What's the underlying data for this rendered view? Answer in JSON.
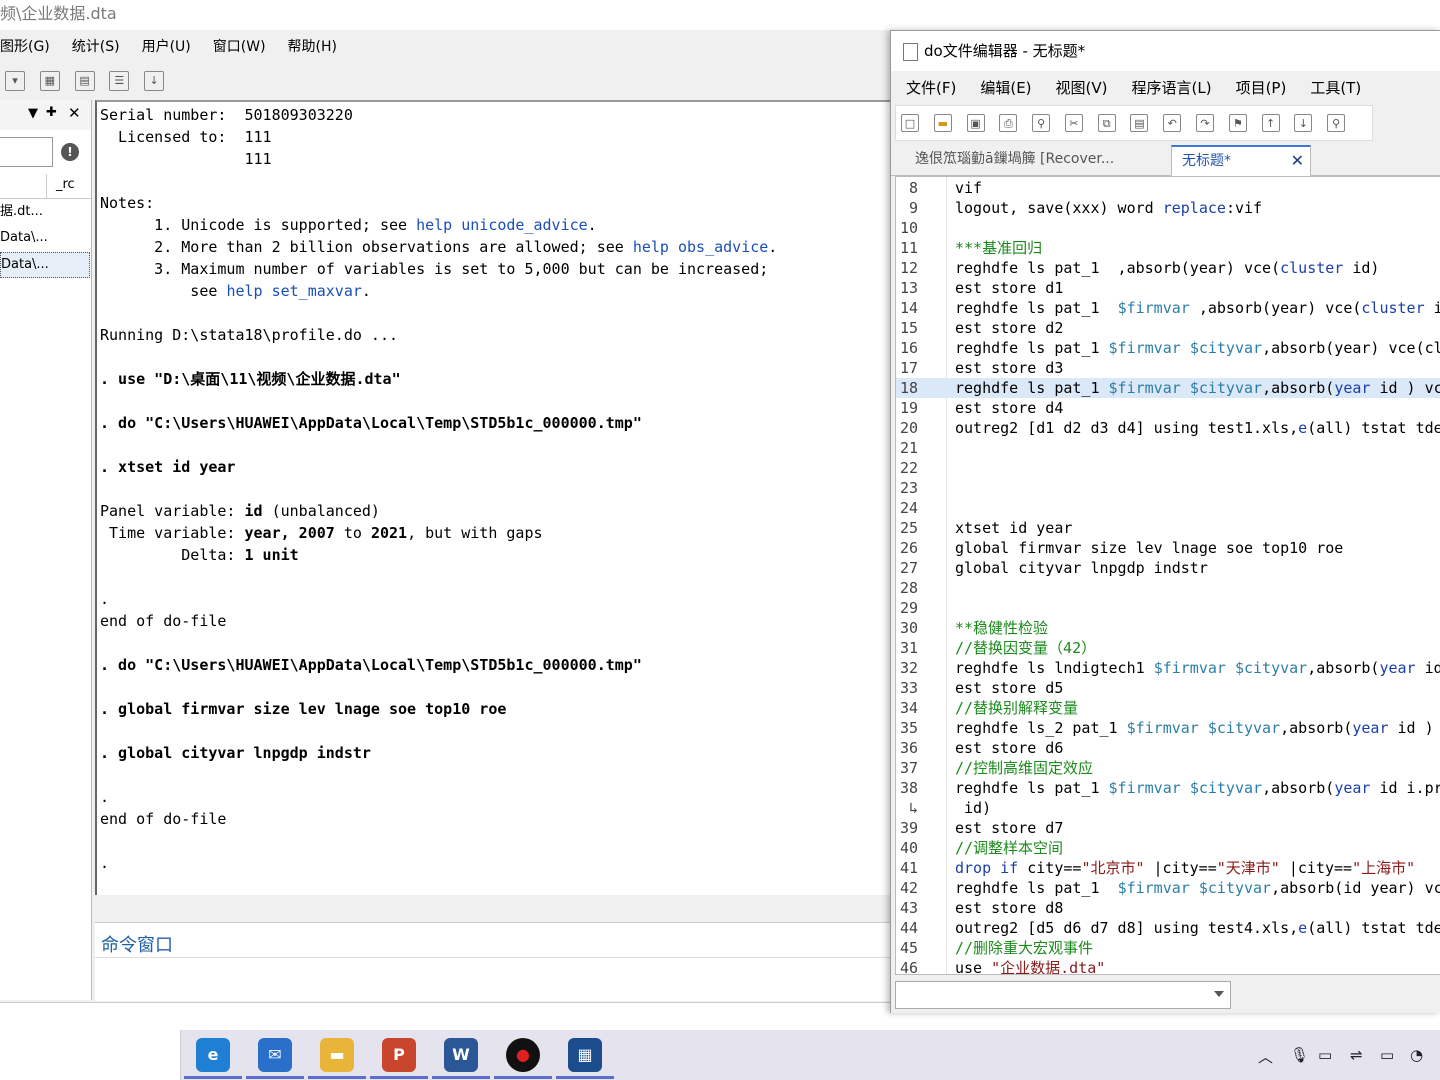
{
  "window": {
    "title": "频\\企业数据.dta"
  },
  "menu": [
    "图形(G)",
    "统计(S)",
    "用户(U)",
    "窗口(W)",
    "帮助(H)"
  ],
  "left_panel": {
    "history_col": "_rc",
    "items": [
      "据.dt...",
      "Data\\...",
      "Data\\..."
    ]
  },
  "results": {
    "lines": [
      {
        "t": "Serial number:  501809303220",
        "b": false
      },
      {
        "t": "  Licensed to:  111",
        "b": false
      },
      {
        "t": "                111",
        "b": false
      },
      {
        "t": "",
        "b": false
      },
      {
        "t": "Notes:",
        "b": false
      },
      {
        "t": "      1. Unicode is supported; see ",
        "b": false,
        "link": "help unicode_advice",
        "end": "."
      },
      {
        "t": "      2. More than 2 billion observations are allowed; see ",
        "b": false,
        "link": "help obs_advice",
        "end": "."
      },
      {
        "t": "      3. Maximum number of variables is set to 5,000 but can be increased;",
        "b": false
      },
      {
        "t": "          see ",
        "b": false,
        "link": "help set_maxvar",
        "end": "."
      },
      {
        "t": "",
        "b": false
      },
      {
        "t": "Running D:\\stata18\\profile.do ...",
        "b": false
      },
      {
        "t": "",
        "b": false
      },
      {
        "t": ". use \"D:\\桌面\\11\\视频\\企业数据.dta\"",
        "b": true
      },
      {
        "t": "",
        "b": false
      },
      {
        "t": ". do \"C:\\Users\\HUAWEI\\AppData\\Local\\Temp\\STD5b1c_000000.tmp\"",
        "b": true
      },
      {
        "t": "",
        "b": false
      },
      {
        "t": ". xtset id year",
        "b": true
      },
      {
        "t": "",
        "b": false
      },
      {
        "t": "Panel variable: ",
        "b": false,
        "bold_tail": "id",
        "tail": " (unbalanced)"
      },
      {
        "t": " Time variable: ",
        "b": false,
        "bold_tail": "year, 2007",
        "tail": " to ",
        "bold_tail2": "2021",
        "tail2": ", but with gaps"
      },
      {
        "t": "         Delta: ",
        "b": false,
        "bold_tail": "1 unit",
        "tail": ""
      },
      {
        "t": "",
        "b": false
      },
      {
        "t": ".",
        "b": false
      },
      {
        "t": "end of do-file",
        "b": false
      },
      {
        "t": "",
        "b": false
      },
      {
        "t": ". do \"C:\\Users\\HUAWEI\\AppData\\Local\\Temp\\STD5b1c_000000.tmp\"",
        "b": true
      },
      {
        "t": "",
        "b": false
      },
      {
        "t": ". global firmvar size lev lnage soe top10 roe",
        "b": true
      },
      {
        "t": "",
        "b": false
      },
      {
        "t": ". global cityvar lnpgdp indstr",
        "b": true
      },
      {
        "t": "",
        "b": false
      },
      {
        "t": ".",
        "b": false
      },
      {
        "t": "end of do-file",
        "b": false
      },
      {
        "t": "",
        "b": false
      },
      {
        "t": ".",
        "b": false
      }
    ]
  },
  "command_window": {
    "label": "命令窗口"
  },
  "editor": {
    "title": "do文件编辑器 - 无标题*",
    "menu": [
      "文件(F)",
      "编辑(E)",
      "视图(V)",
      "程序语言(L)",
      "项目(P)",
      "工具(T)"
    ],
    "tabs": [
      "逸佷笟瑙勭ā鏁堝簲 [Recover...",
      "无标题*"
    ],
    "tab_close": "✕",
    "lines": [
      {
        "n": "8",
        "h": "vif"
      },
      {
        "n": "9",
        "h": "logout, save(xxx) word <span class=\"kw\">replace</span>:vif"
      },
      {
        "n": "10",
        "h": ""
      },
      {
        "n": "11",
        "h": "<span class=\"cm\">***基准回归</span>"
      },
      {
        "n": "12",
        "h": "reghdfe ls pat_1  ,absorb(year) vce(<span class=\"kw\">cluster</span> id)"
      },
      {
        "n": "13",
        "h": "est store d1"
      },
      {
        "n": "14",
        "h": "reghdfe ls pat_1  <span class=\"gv\">$firmvar</span> ,absorb(year) vce(<span class=\"kw\">cluster</span> i"
      },
      {
        "n": "15",
        "h": "est store d2"
      },
      {
        "n": "16",
        "h": "reghdfe ls pat_1 <span class=\"gv\">$firmvar</span> <span class=\"gv\">$cityvar</span>,absorb(year) vce(cl"
      },
      {
        "n": "17",
        "h": "est store d3"
      },
      {
        "n": "18",
        "h": "reghdfe ls pat_1 <span class=\"gv\">$firmvar</span> <span class=\"gv\">$cityvar</span>,absorb(<span class=\"kw\">year</span> id ) vc",
        "hl": true
      },
      {
        "n": "19",
        "h": "est store d4"
      },
      {
        "n": "20",
        "h": "outreg2 [d1 d2 d3 d4] using test1.xls,<span class=\"kw\">e</span>(all) tstat tde"
      },
      {
        "n": "21",
        "h": ""
      },
      {
        "n": "22",
        "h": ""
      },
      {
        "n": "23",
        "h": ""
      },
      {
        "n": "24",
        "h": ""
      },
      {
        "n": "25",
        "h": "xtset id year"
      },
      {
        "n": "26",
        "h": "global firmvar size lev lnage soe top10 roe"
      },
      {
        "n": "27",
        "h": "global cityvar lnpgdp indstr"
      },
      {
        "n": "28",
        "h": ""
      },
      {
        "n": "29",
        "h": ""
      },
      {
        "n": "30",
        "h": "<span class=\"cm\">**稳健性检验</span>"
      },
      {
        "n": "31",
        "h": "<span class=\"cm\">//替换因变量（42）</span>"
      },
      {
        "n": "32",
        "h": "reghdfe ls lndigtech1 <span class=\"gv\">$firmvar</span> <span class=\"gv\">$cityvar</span>,absorb(<span class=\"kw\">year</span> id"
      },
      {
        "n": "33",
        "h": "est store d5"
      },
      {
        "n": "34",
        "h": "<span class=\"cm\">//替换别解释变量</span>"
      },
      {
        "n": "35",
        "h": "reghdfe ls_2 pat_1 <span class=\"gv\">$firmvar</span> <span class=\"gv\">$cityvar</span>,absorb(<span class=\"kw\">year</span> id )"
      },
      {
        "n": "36",
        "h": "est store d6"
      },
      {
        "n": "37",
        "h": "<span class=\"cm\">//控制高维固定效应</span>"
      },
      {
        "n": "38",
        "h": "reghdfe ls pat_1 <span class=\"gv\">$firmvar</span> <span class=\"gv\">$cityvar</span>,absorb(<span class=\"kw\">year</span> id i.pr"
      },
      {
        "n": "↳",
        "h": " id)"
      },
      {
        "n": "39",
        "h": "est store d7"
      },
      {
        "n": "40",
        "h": "<span class=\"cm\">//调整样本空间</span>"
      },
      {
        "n": "41",
        "h": "<span class=\"kw\">drop if</span> city==<span class=\"st\">\"北京市\"</span> |city==<span class=\"st\">\"天津市\"</span> |city==<span class=\"st\">\"上海市\"</span>"
      },
      {
        "n": "42",
        "h": "reghdfe ls pat_1  <span class=\"gv\">$firmvar</span> <span class=\"gv\">$cityvar</span>,absorb(id year) vc"
      },
      {
        "n": "43",
        "h": "est store d8"
      },
      {
        "n": "44",
        "h": "outreg2 [d5 d6 d7 d8] using test4.xls,<span class=\"kw\">e</span>(all) tstat tde"
      },
      {
        "n": "45",
        "h": "<span class=\"cm\">//删除重大宏观事件</span>"
      },
      {
        "n": "46",
        "h": "use <span class=\"st\">\"企业数据.dta\"</span>"
      }
    ]
  },
  "taskbar": {
    "apps": [
      {
        "name": "edge-icon",
        "color": "#1f7fd4",
        "glyph": "e"
      },
      {
        "name": "mail-icon",
        "color": "#2a6fc9",
        "glyph": "✉"
      },
      {
        "name": "file-explorer-icon",
        "color": "#e8b43a",
        "glyph": "▬"
      },
      {
        "name": "powerpoint-icon",
        "color": "#c8472c",
        "glyph": "P"
      },
      {
        "name": "word-icon",
        "color": "#2b5797",
        "glyph": "W"
      },
      {
        "name": "recorder-icon",
        "color": "#111111",
        "glyph": "●"
      },
      {
        "name": "stata-icon",
        "color": "#1b4c8c",
        "glyph": "▦"
      }
    ]
  }
}
